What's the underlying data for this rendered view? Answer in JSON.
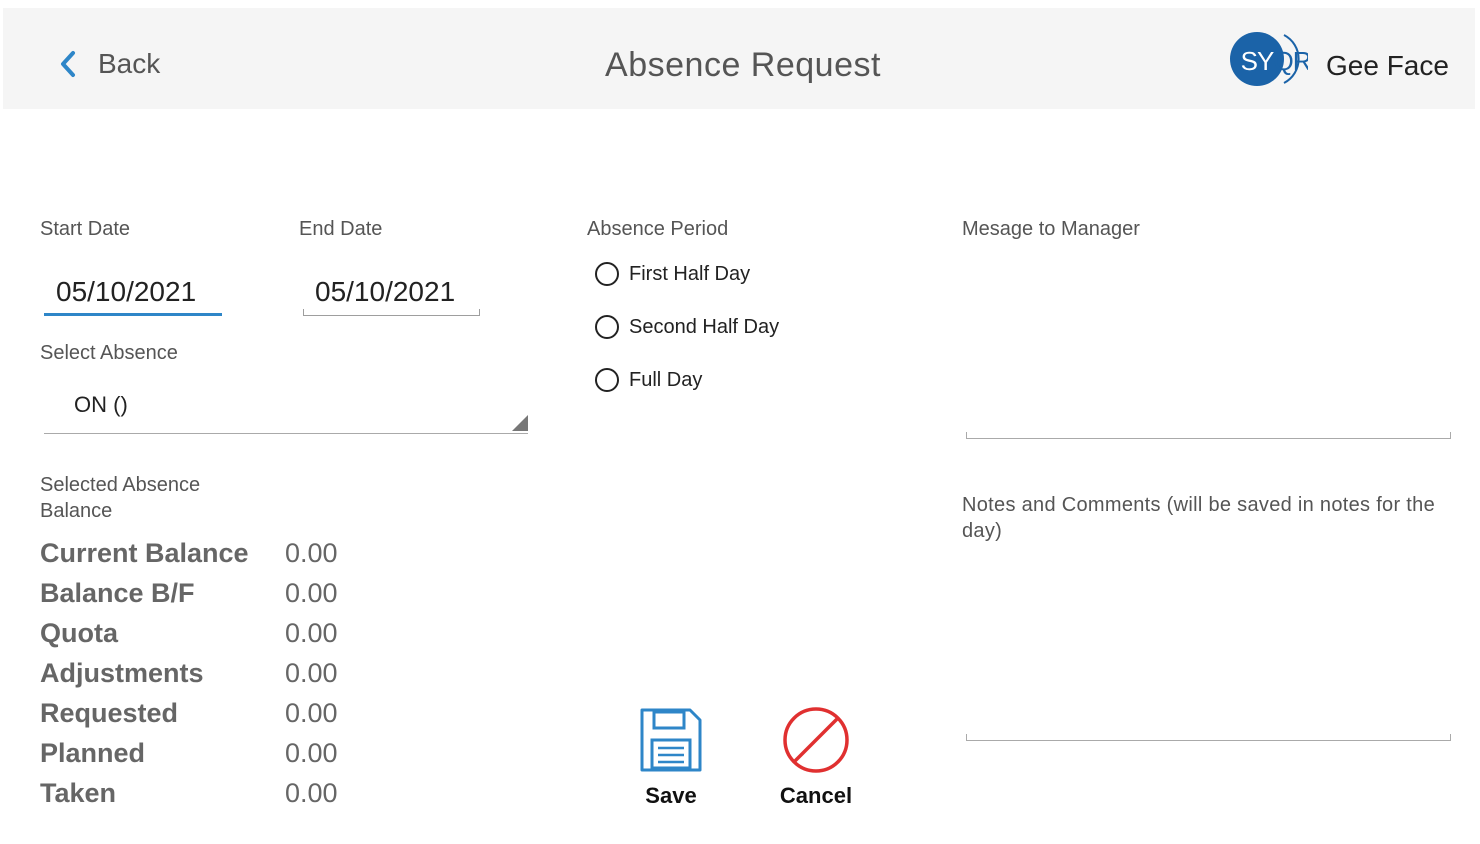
{
  "header": {
    "back_label": "Back",
    "title": "Absence Request",
    "logo_text": "SYQR",
    "user_name": "Gee Face"
  },
  "form": {
    "start_date_label": "Start Date",
    "start_date_value": "05/10/2021",
    "end_date_label": "End Date",
    "end_date_value": "05/10/2021",
    "select_absence_label": "Select Absence",
    "select_absence_value": "ON ()",
    "absence_period_label": "Absence Period",
    "absence_period_options": [
      {
        "label": "First Half Day",
        "selected": false
      },
      {
        "label": "Second Half Day",
        "selected": false
      },
      {
        "label": "Full Day",
        "selected": false
      }
    ],
    "message_label": "Mesage to Manager",
    "message_value": "",
    "notes_label": "Notes and Comments (will be saved in notes for the day)",
    "notes_value": ""
  },
  "balance": {
    "caption": "Selected Absence Balance",
    "rows": [
      {
        "name": "Current Balance",
        "value": "0.00"
      },
      {
        "name": "Balance B/F",
        "value": "0.00"
      },
      {
        "name": "Quota",
        "value": "0.00"
      },
      {
        "name": "Adjustments",
        "value": "0.00"
      },
      {
        "name": "Requested",
        "value": "0.00"
      },
      {
        "name": "Planned",
        "value": "0.00"
      },
      {
        "name": "Taken",
        "value": "0.00"
      }
    ]
  },
  "actions": {
    "save_label": "Save",
    "cancel_label": "Cancel"
  },
  "colors": {
    "accent": "#2e86c8",
    "logo": "#1b63a8",
    "cancel": "#e03030",
    "header_bg": "#f5f5f5"
  },
  "icons": [
    "chevron-left-icon",
    "floppy-disk-icon",
    "no-entry-icon"
  ]
}
